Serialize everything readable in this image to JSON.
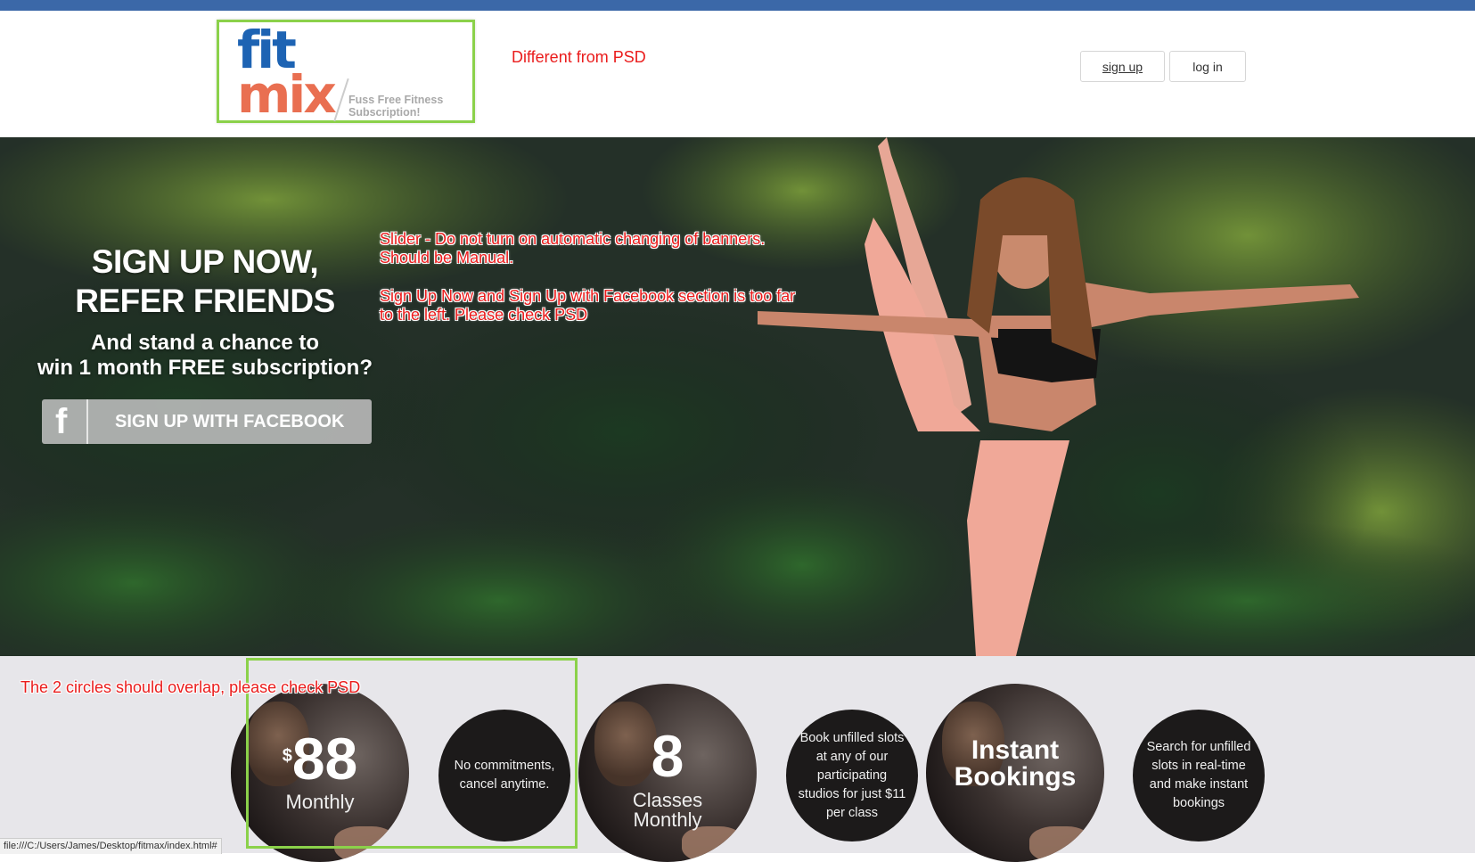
{
  "header": {
    "logo_top": "fit",
    "logo_bottom": "mix",
    "logo_tagline_1": "Fuss Free Fitness",
    "logo_tagline_2": "Subscription!",
    "signup_label": "sign up",
    "login_label": "log in"
  },
  "annotations": {
    "logo_note": "Different from PSD",
    "slider_note_1": "Slider - Do not turn on automatic changing of banners.",
    "slider_note_2": "Should be Manual.",
    "position_note_1": "Sign Up Now and Sign Up with Facebook section is too far",
    "position_note_2": "to the left. Please check PSD",
    "circles_note": "The 2 circles should overlap, please check PSD"
  },
  "hero": {
    "headline_1": "SIGN UP NOW,",
    "headline_2": "REFER FRIENDS",
    "subline_1": "And stand a chance to",
    "subline_2": "win 1 month FREE subscription?",
    "facebook_icon_glyph": "f",
    "facebook_button_label": "SIGN UP WITH FACEBOOK"
  },
  "features": {
    "price_currency": "$",
    "price_value": "88",
    "price_caption": "Monthly",
    "price_desc": "No commitments, cancel anytime.",
    "classes_value": "8",
    "classes_caption_1": "Classes",
    "classes_caption_2": "Monthly",
    "classes_desc": "Book unfilled slots at any of our participating studios for just $11 per class",
    "bookings_title_1": "Instant",
    "bookings_title_2": "Bookings",
    "bookings_desc": "Search for unfilled slots in real-time and make instant bookings"
  },
  "statusbar": {
    "url": "file:///C:/Users/James/Desktop/fitmax/index.html#"
  },
  "colors": {
    "topbar": "#3b68a8",
    "annotation": "#ea1c1c",
    "highlight_box": "#8bd14a",
    "logo_blue": "#1d63b3",
    "logo_orange": "#e96f51"
  }
}
